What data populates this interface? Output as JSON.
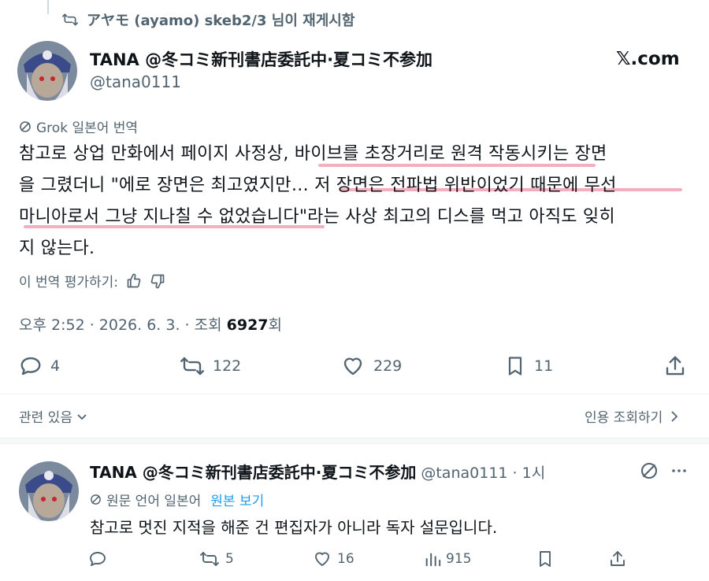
{
  "repost": {
    "text": "アヤモ (ayamo) skeb2/3 님이 재게시함"
  },
  "post": {
    "display_name": "TANA @冬コミ新刊書店委託中·夏コミ不参加",
    "handle": "@tana0111",
    "brand": "𝕏.com",
    "translate_label": "Grok 일본어 번역",
    "body_lines": [
      "참고로 상업 만화에서 페이지 사정상, 바이브를 초장거리로 원격 작동시키는 장면",
      "을 그렸더니 \"에로 장면은 최고였지만… 저 장면은 전파법 위반이었기 때문에 무선",
      "마니아로서 그냥 지나칠 수 없었습니다\"라는 사상 최고의 디스를 먹고 아직도 잊히",
      "지 않는다."
    ],
    "rate_label": "이 번역 평가하기:",
    "meta_time": "오후 2:52 · 2026. 6. 3. · 조회 ",
    "meta_views": "6927",
    "meta_views_suffix": "회",
    "actions": {
      "reply": "4",
      "repost": "122",
      "like": "229",
      "bookmark": "11"
    },
    "related_label": "관련 있음",
    "quotes_label": "인용 조회하기"
  },
  "reply": {
    "display_name": "TANA @冬コミ新刊書店委託中·夏コミ不参加",
    "handle_time": "@tana0111 · 1시",
    "source_lang": "원문 언어 일본어",
    "show_original": "원본 보기",
    "text": "참고로 멋진 지적을 해준 건 편집자가 아니라 독자 설문입니다.",
    "actions": {
      "reply": "",
      "repost": "5",
      "like": "16",
      "views": "915"
    }
  },
  "colors": {
    "accent": "#1d9bf0",
    "muted": "#536471",
    "highlight": "#f2a6b8"
  }
}
